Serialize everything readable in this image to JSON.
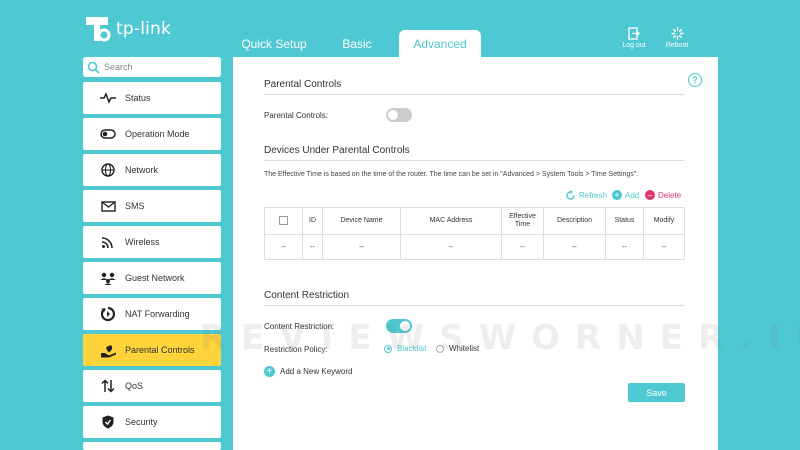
{
  "header": {
    "brand": "tp-link",
    "tabs": [
      "Quick Setup",
      "Basic",
      "Advanced"
    ],
    "active_tab": "Advanced",
    "logout_label": "Log out",
    "reboot_label": "Reboot"
  },
  "sidebar": {
    "search_placeholder": "Search",
    "items": [
      {
        "label": "Status",
        "icon": "pulse-icon"
      },
      {
        "label": "Operation Mode",
        "icon": "toggle-icon"
      },
      {
        "label": "Network",
        "icon": "globe-icon"
      },
      {
        "label": "SMS",
        "icon": "envelope-icon"
      },
      {
        "label": "Wireless",
        "icon": "wifi-icon"
      },
      {
        "label": "Guest Network",
        "icon": "guest-users-icon"
      },
      {
        "label": "NAT Forwarding",
        "icon": "nat-cycle-icon"
      },
      {
        "label": "Parental Controls",
        "icon": "heart-hand-icon",
        "active": true
      },
      {
        "label": "QoS",
        "icon": "up-down-arrows-icon"
      },
      {
        "label": "Security",
        "icon": "shield-icon"
      }
    ]
  },
  "main": {
    "parental": {
      "title": "Parental Controls",
      "toggle_label": "Parental Controls:",
      "enabled": false
    },
    "devices": {
      "title": "Devices Under Parental Controls",
      "note": "The Effective Time is based on the time of the router. The time can be set in \"Advanced > System Tools > Time Settings\".",
      "refresh_label": "Refresh",
      "add_label": "Add",
      "delete_label": "Delete",
      "columns": [
        "ID",
        "Device Name",
        "MAC Address",
        "Effective Time",
        "Description",
        "Status",
        "Modify"
      ],
      "rows": [
        [
          "--",
          "--",
          "--",
          "--",
          "--",
          "--",
          "--",
          "--"
        ]
      ]
    },
    "content": {
      "title": "Content Restriction",
      "toggle_label": "Content Restriction:",
      "enabled": true,
      "policy_label": "Restriction Policy:",
      "blacklist_label": "Blacklist",
      "whitelist_label": "Whitelist",
      "selected_policy": "Blacklist",
      "add_keyword_label": "Add a New Keyword"
    },
    "save_label": "Save"
  },
  "watermark": "REVIEWSWORNER.IU",
  "colors": {
    "accent": "#4ec8d2",
    "active_item": "#ffd43a",
    "delete": "#e0336b"
  }
}
